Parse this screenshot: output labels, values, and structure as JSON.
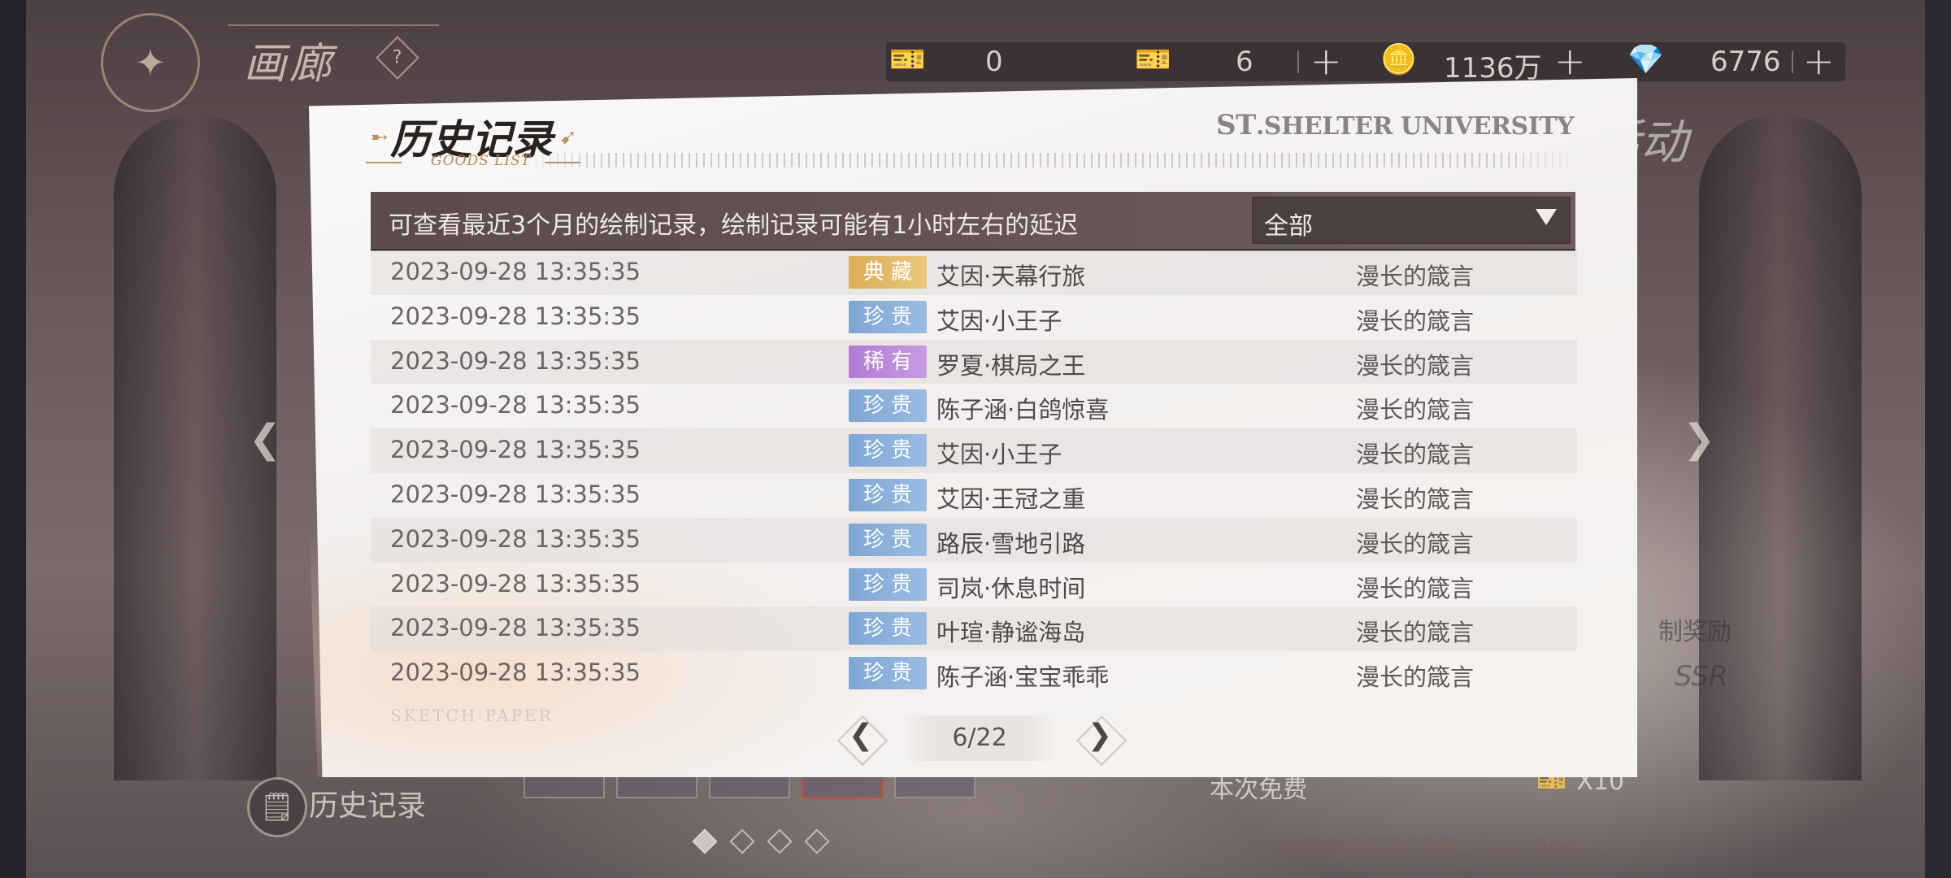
{
  "gallery": {
    "title": "画廊",
    "help": "?"
  },
  "currency": [
    {
      "icon": "ticket-icon",
      "value": "0",
      "plus": false
    },
    {
      "icon": "ticket-icon",
      "value": "6",
      "plus": true
    },
    {
      "icon": "coin-icon",
      "value": "1136万",
      "plus": true
    },
    {
      "icon": "diamond-icon",
      "value": "6776",
      "plus": true
    }
  ],
  "plus_symbol": "+",
  "background": {
    "activity": "活动",
    "reward_text": "制奖励",
    "ssr_text": "SSR",
    "free_text": "本次免费",
    "x10_text": "X10",
    "remaining_text": "今日剩余绘制次数：190/999",
    "history_button": "历史记录"
  },
  "modal": {
    "title": "历史记录",
    "subtitle": "GOODS LIST",
    "brand_st": "ST",
    "brand_rest": ".SHELTER UNIVERSITY",
    "notice": "可查看最近3个月的绘制记录，绘制记录可能有1小时左右的延迟",
    "filter": {
      "selected": "全部"
    },
    "watermark": "SKETCH PAPER",
    "rows": [
      {
        "time": "2023-09-28  13:35:35",
        "rarity": "典藏",
        "rarity_color": "#d9ae5a",
        "name": "艾因·天幕行旅",
        "pool": "漫长的箴言"
      },
      {
        "time": "2023-09-28  13:35:35",
        "rarity": "珍贵",
        "rarity_color": "#7ea6d3",
        "name": "艾因·小王子",
        "pool": "漫长的箴言"
      },
      {
        "time": "2023-09-28  13:35:35",
        "rarity": "稀有",
        "rarity_color": "#b17ad4",
        "name": "罗夏·棋局之王",
        "pool": "漫长的箴言"
      },
      {
        "time": "2023-09-28  13:35:35",
        "rarity": "珍贵",
        "rarity_color": "#7ea6d3",
        "name": "陈子涵·白鸽惊喜",
        "pool": "漫长的箴言"
      },
      {
        "time": "2023-09-28  13:35:35",
        "rarity": "珍贵",
        "rarity_color": "#7ea6d3",
        "name": "艾因·小王子",
        "pool": "漫长的箴言"
      },
      {
        "time": "2023-09-28  13:35:35",
        "rarity": "珍贵",
        "rarity_color": "#7ea6d3",
        "name": "艾因·王冠之重",
        "pool": "漫长的箴言"
      },
      {
        "time": "2023-09-28  13:35:35",
        "rarity": "珍贵",
        "rarity_color": "#7ea6d3",
        "name": "路辰·雪地引路",
        "pool": "漫长的箴言"
      },
      {
        "time": "2023-09-28  13:35:35",
        "rarity": "珍贵",
        "rarity_color": "#7ea6d3",
        "name": "司岚·休息时间",
        "pool": "漫长的箴言"
      },
      {
        "time": "2023-09-28  13:35:35",
        "rarity": "珍贵",
        "rarity_color": "#7ea6d3",
        "name": "叶瑄·静谧海岛",
        "pool": "漫长的箴言"
      },
      {
        "time": "2023-09-28  13:35:35",
        "rarity": "珍贵",
        "rarity_color": "#7ea6d3",
        "name": "陈子涵·宝宝乖乖",
        "pool": "漫长的箴言"
      }
    ],
    "pager": {
      "current": 6,
      "total": 22,
      "text": "6/22"
    }
  }
}
